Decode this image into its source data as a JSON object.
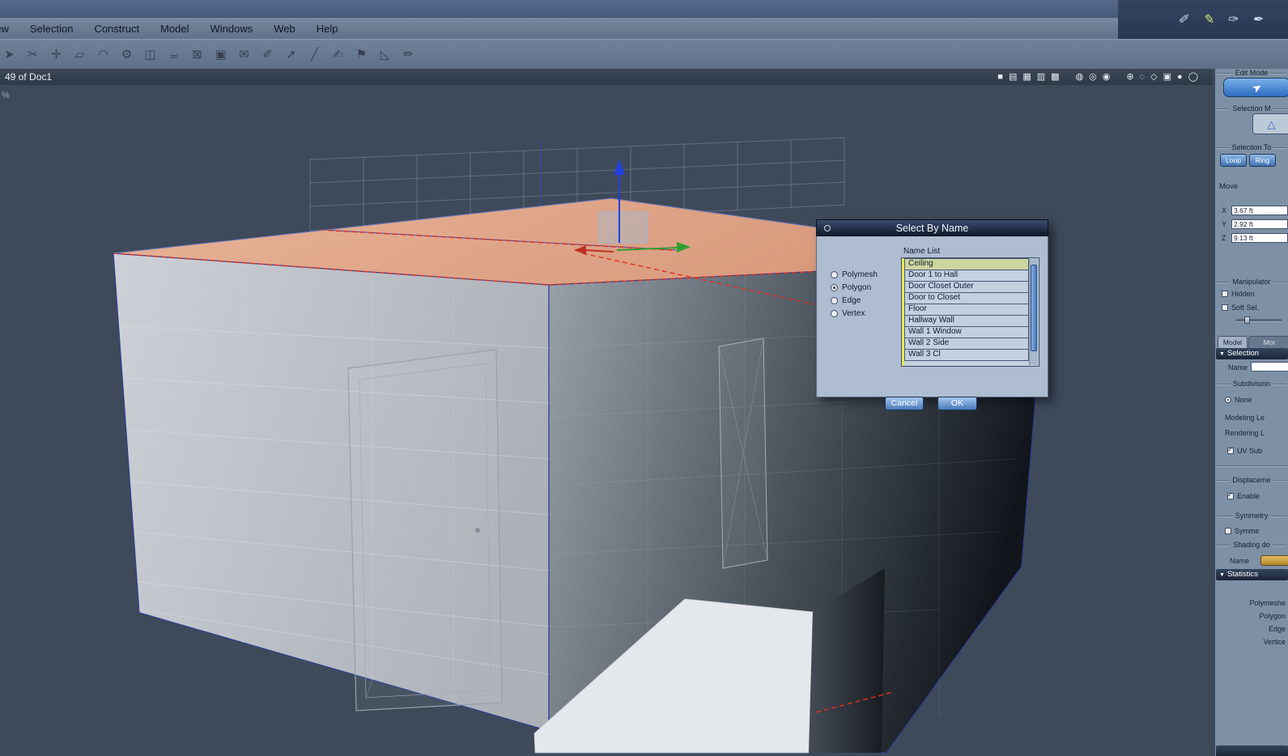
{
  "window": {
    "doc_label": "49 of Doc1",
    "zoom_fragment": "%"
  },
  "menubar": {
    "items": [
      "View",
      "Selection",
      "Construct",
      "Model",
      "Windows",
      "Web",
      "Help"
    ],
    "corner_tools": [
      {
        "name": "lasso-tool",
        "glyph": "✐"
      },
      {
        "name": "freehand-select-tool",
        "glyph": "✎"
      },
      {
        "name": "pen-select-tool",
        "glyph": "✑"
      },
      {
        "name": "ink-select-tool",
        "glyph": "✒"
      }
    ]
  },
  "toolbar": {
    "icons": [
      {
        "name": "select-tool",
        "glyph": "➤"
      },
      {
        "name": "cut-tool",
        "glyph": "✂"
      },
      {
        "name": "snap-tool",
        "glyph": "✛"
      },
      {
        "name": "rect-tool",
        "glyph": "▱"
      },
      {
        "name": "dome-tool",
        "glyph": "◠"
      },
      {
        "name": "settings-tool",
        "glyph": "⚙"
      },
      {
        "name": "window-tool",
        "glyph": "◫"
      },
      {
        "name": "cup-tool",
        "glyph": "☕"
      },
      {
        "name": "delete-tool",
        "glyph": "⊠"
      },
      {
        "name": "cube-tool",
        "glyph": "▣"
      },
      {
        "name": "envelope-tool",
        "glyph": "✉"
      },
      {
        "name": "pencil-tool",
        "glyph": "✐"
      },
      {
        "name": "arrow-up-tool",
        "glyph": "➚"
      },
      {
        "name": "line-tool",
        "glyph": "╱"
      },
      {
        "name": "hand-draw-tool",
        "glyph": "✍"
      },
      {
        "name": "flag-tool",
        "glyph": "⚑"
      },
      {
        "name": "triangle-tool",
        "glyph": "◺"
      },
      {
        "name": "pen-tool",
        "glyph": "✏"
      }
    ]
  },
  "viewport": {
    "view_icons": [
      {
        "name": "single-view",
        "glyph": "■"
      },
      {
        "name": "rows-view",
        "glyph": "▤"
      },
      {
        "name": "grid-view",
        "glyph": "▦"
      },
      {
        "name": "cols-view",
        "glyph": "▥"
      },
      {
        "name": "quad-view",
        "glyph": "▩"
      },
      {
        "name": "shaded-ball",
        "glyph": "◍"
      },
      {
        "name": "wire-ball",
        "glyph": "◎"
      },
      {
        "name": "textured-ball",
        "glyph": "◉"
      },
      {
        "name": "orbit",
        "glyph": "⊕"
      },
      {
        "name": "dotted-circle",
        "glyph": "◌"
      },
      {
        "name": "diamond-view",
        "glyph": "◇"
      },
      {
        "name": "cube-view",
        "glyph": "▣"
      },
      {
        "name": "light-ball",
        "glyph": "●"
      },
      {
        "name": "outline-ball",
        "glyph": "◯"
      }
    ]
  },
  "dialog": {
    "title": "Select By Name",
    "name_list_label": "Name List",
    "radios": [
      {
        "label": "Polymesh"
      },
      {
        "label": "Polygon"
      },
      {
        "label": "Edge"
      },
      {
        "label": "Vertex"
      }
    ],
    "selected_radio": "Polygon",
    "items": [
      "Ceiling",
      "Door 1 to Hall",
      "Door Closet Outer",
      "Door to Closet",
      "Floor",
      "Hallway Wall",
      "Wall 1 Window",
      "Wall 2 Side",
      "Wall 3 Cl"
    ],
    "selected_item": "Ceiling",
    "cancel_label": "Cancel",
    "ok_label": "OK"
  },
  "panel": {
    "edit_mode_label": "Edit Mode",
    "edit_mode_glyph": "➤",
    "selection_mode_label": "Selection M",
    "selection_mode_glyph": "△",
    "selection_tool_label": "Selection To",
    "loop_label": "Loop",
    "ring_label": "Ring",
    "move_label": "Move",
    "move": [
      {
        "axis": "X",
        "value": "3.67 ft"
      },
      {
        "axis": "Y",
        "value": "2.92 ft"
      },
      {
        "axis": "Z",
        "value": "9.13 ft"
      }
    ],
    "manipulator_label": "Manipulator",
    "hidden_label": "Hidden",
    "soft_sel_label": "Soft Sel.",
    "tabs": [
      "Model",
      "Mor"
    ],
    "collapse_icon": "▼",
    "selection_header": "Selection",
    "name_label": "Name",
    "subdivision_label": "Subdivision",
    "none_label": "None",
    "modeling_level_label": "Modeling Le",
    "rendering_level_label": "Rendering L",
    "uv_sub_label": "UV Sub",
    "displacement_label": "Displaceme",
    "enable_label": "Enable",
    "symmetry_label": "Symmetry",
    "symmetry_cb_label": "Symme",
    "shading_label": "Shading do",
    "shading_name_label": "Name",
    "statistics_header": "Statistics",
    "stats": [
      "Polymeshe",
      "Polygon",
      "Edge",
      "Vertice"
    ]
  },
  "colors": {
    "viewport_bg": "#3e4a5a",
    "menubar_bg": "#6b7d94",
    "selected_face_salmon": "#dd9e7f",
    "dialog_body": "#aebdd0",
    "button_blue": "#477ab8",
    "wire_blue": "#2e3f9e",
    "selected_edge_red": "#e03020",
    "axis_green": "#2f9e30",
    "axis_blue": "#2040e0",
    "axis_red": "#c03020"
  }
}
